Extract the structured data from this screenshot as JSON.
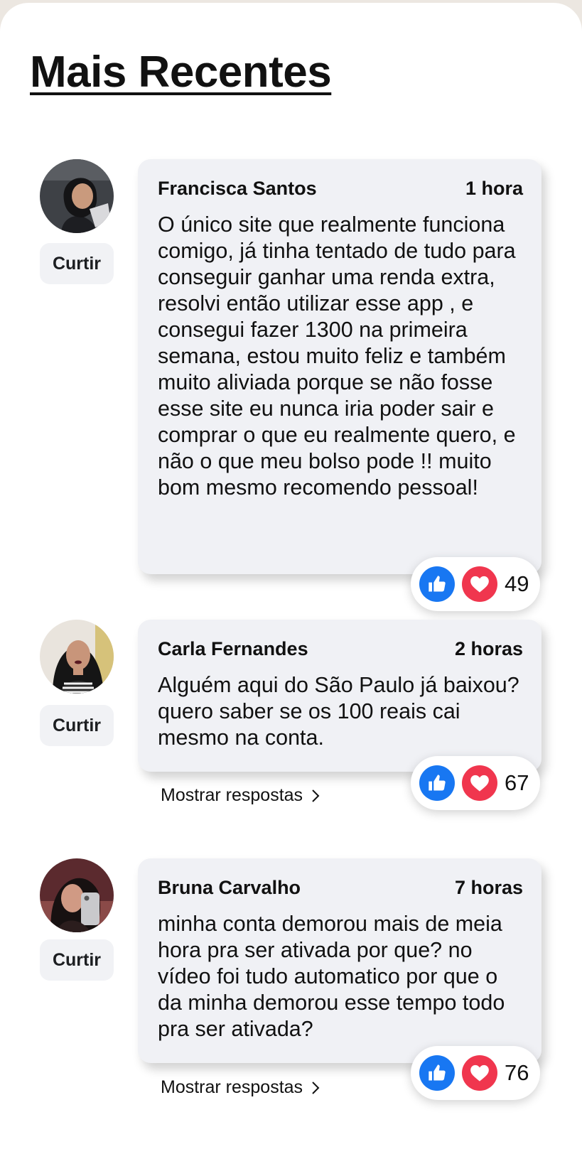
{
  "page": {
    "title": "Mais Recentes"
  },
  "comments": [
    {
      "author": "Francisca Santos",
      "time": "1 hora",
      "text": "O único site que realmente funciona comigo, já tinha tentado de tudo para conseguir ganhar uma renda extra, resolvi então utilizar esse app , e consegui fazer 1300 na primeira semana, estou muito feliz e também muito aliviada porque se não fosse esse site eu nunca iria poder sair e comprar o que eu realmente quero, e não o que meu bolso pode !! muito bom mesmo recomendo pessoal!",
      "like_label": "Curtir",
      "reaction_count": "49",
      "reactions": [
        "like-icon",
        "heart-icon"
      ]
    },
    {
      "author": "Carla Fernandes",
      "time": "2 horas",
      "text": "Alguém aqui do São Paulo já baixou? quero saber se os 100 reais cai mesmo na conta.",
      "like_label": "Curtir",
      "reaction_count": "67",
      "reactions": [
        "like-icon",
        "heart-icon"
      ],
      "replies_label": "Mostrar respostas"
    },
    {
      "author": "Bruna Carvalho",
      "time": "7 horas",
      "text": "minha conta demorou mais de meia hora pra ser ativada por que? no vídeo foi tudo automatico por que o da minha demorou esse tempo todo pra ser ativada?",
      "like_label": "Curtir",
      "reaction_count": "76",
      "reactions": [
        "like-icon",
        "heart-icon"
      ],
      "replies_label": "Mostrar respostas"
    }
  ],
  "colors": {
    "like_blue": "#1877f2",
    "love_red": "#f0364e",
    "bubble_bg": "#f0f1f5"
  }
}
